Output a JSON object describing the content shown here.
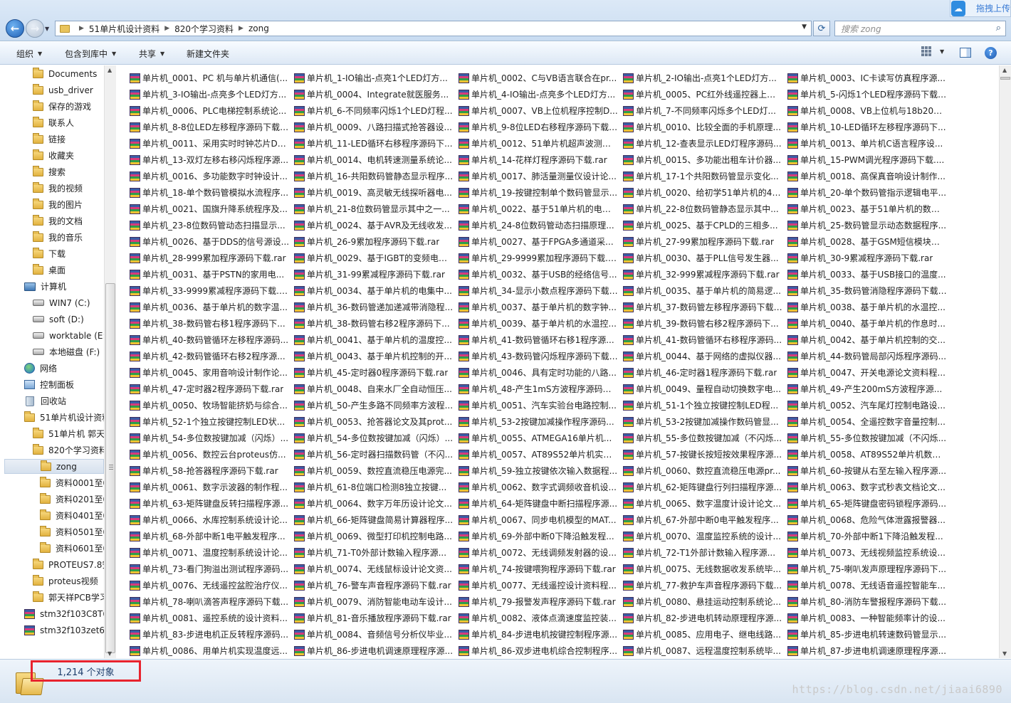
{
  "address": {
    "breadcrumbs": [
      "51单片机设计资料",
      "820个学习资料",
      "zong"
    ]
  },
  "search": {
    "placeholder": "搜索 zong"
  },
  "top_widget": {
    "label": "拖拽上传"
  },
  "toolbar": {
    "organize": "组织",
    "include_in_library": "包含到库中",
    "share": "共享",
    "new_folder": "新建文件夹"
  },
  "nav": {
    "items": [
      {
        "label": "Documents",
        "icon": "folder"
      },
      {
        "label": "usb_driver",
        "icon": "folder"
      },
      {
        "label": "保存的游戏",
        "icon": "folder"
      },
      {
        "label": "联系人",
        "icon": "folder"
      },
      {
        "label": "链接",
        "icon": "folder"
      },
      {
        "label": "收藏夹",
        "icon": "folder"
      },
      {
        "label": "搜索",
        "icon": "folder"
      },
      {
        "label": "我的视频",
        "icon": "folder"
      },
      {
        "label": "我的图片",
        "icon": "folder"
      },
      {
        "label": "我的文档",
        "icon": "folder"
      },
      {
        "label": "我的音乐",
        "icon": "folder"
      },
      {
        "label": "下载",
        "icon": "folder"
      },
      {
        "label": "桌面",
        "icon": "folder"
      },
      {
        "label": "计算机",
        "icon": "computer"
      },
      {
        "label": "WIN7 (C:)",
        "icon": "drive"
      },
      {
        "label": "soft (D:)",
        "icon": "drive"
      },
      {
        "label": "worktable (E:)",
        "icon": "drive"
      },
      {
        "label": "本地磁盘 (F:)",
        "icon": "drive"
      },
      {
        "label": "网络",
        "icon": "network"
      },
      {
        "label": "控制面板",
        "icon": "control-panel"
      },
      {
        "label": "回收站",
        "icon": "recycle-bin"
      },
      {
        "label": "51单片机设计资料",
        "icon": "folder"
      },
      {
        "label": "51单片机 郭天祥",
        "icon": "folder"
      },
      {
        "label": "820个学习资料",
        "icon": "folder"
      },
      {
        "label": "zong",
        "icon": "folder"
      },
      {
        "label": "资料0001至0200",
        "icon": "folder"
      },
      {
        "label": "资料0201至0400",
        "icon": "folder"
      },
      {
        "label": "资料0401至0500",
        "icon": "folder"
      },
      {
        "label": "资料0501至0600",
        "icon": "folder"
      },
      {
        "label": "资料0601至0820",
        "icon": "folder"
      },
      {
        "label": "PROTEUS7.8安装包",
        "icon": "folder"
      },
      {
        "label": "proteus视频",
        "icon": "folder"
      },
      {
        "label": "郭天祥PCB学习",
        "icon": "folder"
      },
      {
        "label": "stm32f103C8T6",
        "icon": "archive"
      },
      {
        "label": "stm32f103zet6",
        "icon": "archive"
      }
    ]
  },
  "files": [
    "单片机_0001、PC 机与单片机通信(...",
    "单片机_1-IO输出-点亮1个LED灯方...",
    "单片机_0002、C与VB语言联合在pr...",
    "单片机_2-IO输出-点亮1个LED灯方...",
    "单片机_0003、IC卡读写仿真程序源...",
    "单片机_3-IO输出-点亮多个LED灯方...",
    "单片机_0004、Integrate就医服务...",
    "单片机_4-IO输出-点亮多个LED灯方...",
    "单片机_0005、PC红外线遥控器上位...",
    "单片机_5-闪烁1个LED程序源码下载....",
    "单片机_0006、PLC电梯控制系统论...",
    "单片机_6-不同频率闪烁1个LED灯程...",
    "单片机_0007、VB上位机程序控制D...",
    "单片机_7-不同频率闪烁多个LED灯...",
    "单片机_0008、VB上位机与18b20下...",
    "单片机_8-8位LED左移程序源码下载....",
    "单片机_0009、八路扫描式抢答器设...",
    "单片机_9-8位LED右移程序源码下载....",
    "单片机_0010、比较全面的手机原理...",
    "单片机_10-LED循环左移程序源码下...",
    "单片机_0011、采用实时时钟芯片DS...",
    "单片机_11-LED循环右移程序源码下...",
    "单片机_0012、51单片机超声波测距...",
    "单片机_12-查表显示LED灯程序源码...",
    "单片机_0013、单片机C语言程序设...",
    "单片机_13-双灯左移右移闪烁程序源...",
    "单片机_0014、电机转速测量系统论...",
    "单片机_14-花样灯程序源码下载.rar",
    "单片机_0015、多功能出租车计价器...",
    "单片机_15-PWM调光程序源码下载....",
    "单片机_0016、多功能数字时钟设计...",
    "单片机_16-共阳数码管静态显示程序...",
    "单片机_0017、肺活量测量仪设计论...",
    "单片机_17-1个共阳数码管显示变化...",
    "单片机_0018、高保真音响设计制作...",
    "单片机_18-单个数码管模拟水流程序...",
    "单片机_0019、高灵敏无线探听器电...",
    "单片机_19-按键控制单个数码管显示...",
    "单片机_0020、给初学51单片机的40...",
    "单片机_20-单个数码管指示逻辑电平...",
    "单片机_0021、国旗升降系统程序及...",
    "单片机_21-8位数码管显示其中之一...",
    "单片机_0022、基于51单片机的电子...",
    "单片机_22-8位数码管静态显示其中...",
    "单片机_0023、基于51单片机的数字...",
    "单片机_23-8位数码管动态扫描显示...",
    "单片机_0024、基于AVR及无线收发...",
    "单片机_24-8位数码管动态扫描原理...",
    "单片机_0025、基于CPLD的三相多...",
    "单片机_25-数码管显示动态数据程序...",
    "单片机_0026、基于DDS的信号源设...",
    "单片机_26-9累加程序源码下载.rar",
    "单片机_0027、基于FPGA多通道采...",
    "单片机_27-99累加程序源码下载.rar",
    "单片机_0028、基于GSM短信模块的...",
    "单片机_28-999累加程序源码下载.rar",
    "单片机_0029、基于IGBT的变频电源...",
    "单片机_29-9999累加程序源码下载.r...",
    "单片机_0030、基于PLL信号发生器...",
    "单片机_30-9累减程序源码下载.rar",
    "单片机_0031、基于PSTN的家用电...",
    "单片机_31-99累减程序源码下载.rar",
    "单片机_0032、基于USB的经络信号...",
    "单片机_32-999累减程序源码下载.rar",
    "单片机_0033、基于USB接口的温度...",
    "单片机_33-9999累减程序源码下载.r...",
    "单片机_0034、基于单片机的电集中...",
    "单片机_34-显示小数点程序源码下载....",
    "单片机_0035、基于单片机的简易逻...",
    "单片机_35-数码管消隐程序源码下载....",
    "单片机_0036、基于单片机的数字温...",
    "单片机_36-数码管递加递减带消隐程...",
    "单片机_0037、基于单片机的数字钟...",
    "单片机_37-数码管左移程序源码下载....",
    "单片机_0038、基于单片机的水温控...",
    "单片机_38-数码管右移1程序源码下...",
    "单片机_38-数码管右移2程序源码下...",
    "单片机_0039、基于单片机的水温控...",
    "单片机_39-数码管右移2程序源码下...",
    "单片机_0040、基于单片机的作息时...",
    "单片机_40-数码管循环左移程序源码...",
    "单片机_0041、基于单片机的温度控...",
    "单片机_41-数码管循环右移1程序源...",
    "单片机_41-数码管循环右移程序源码...",
    "单片机_0042、基于单片机控制的交...",
    "单片机_42-数码管循环右移2程序源...",
    "单片机_0043、基于单片机控制的开...",
    "单片机_43-数码管闪烁程序源码下载....",
    "单片机_0044、基于网络的虚拟仪器...",
    "单片机_44-数码管局部闪烁程序源码...",
    "单片机_0045、家用音响设计制作论...",
    "单片机_45-定时器0程序源码下载.rar",
    "单片机_0046、具有定时功能的八路...",
    "单片机_46-定时器1程序源码下载.rar",
    "单片机_0047、开关电源论文资料程...",
    "单片机_47-定时器2程序源码下载.rar",
    "单片机_0048、自来水厂全自动恒压...",
    "单片机_48-产生1mS方波程序源码下...",
    "单片机_0049、量程自动切换数字电...",
    "单片机_49-产生200mS方波程序源...",
    "单片机_0050、牧场智能挤奶与综合...",
    "单片机_50-产生多路不同频率方波程...",
    "单片机_0051、汽车实验台电路控制...",
    "单片机_51-1个独立按键控制LED程...",
    "单片机_0052、汽车尾灯控制电路设...",
    "单片机_52-1个独立按键控制LED状...",
    "单片机_0053、抢答器论文及其prot...",
    "单片机_53-2按键加减操作程序源码...",
    "单片机_53-2按键加减操作数码管显...",
    "单片机_0054、全遥控数字音量控制...",
    "单片机_54-多位数按键加减（闪烁）...",
    "单片机_54-多位数按键加减（闪烁）...",
    "单片机_0055、ATMEGA16单片机...",
    "单片机_55-多位数按键加减（不闪烁...",
    "单片机_55-多位数按键加减（不闪烁...",
    "单片机_0056、数控云台proteus仿...",
    "单片机_56-定时器扫描数码管（不闪...",
    "单片机_0057、AT89S52单片机实现...",
    "单片机_57-按键长按短按效果程序源...",
    "单片机_0058、AT89S52单片机数控...",
    "单片机_58-抢答器程序源码下载.rar",
    "单片机_0059、数控直流稳压电源完...",
    "单片机_59-独立按键依次输入数据程...",
    "单片机_0060、数控直流稳压电源pr...",
    "单片机_60-按键从右至左输入程序源...",
    "单片机_0061、数字示波器的制作程...",
    "单片机_61-8位端口检测8独立按键...",
    "单片机_0062、数字式调频收音机设...",
    "单片机_62-矩阵键盘行列扫描程序源...",
    "单片机_0063、数字式秒表文档论文...",
    "单片机_63-矩阵键盘反转扫描程序源...",
    "单片机_0064、数字万年历设计论文...",
    "单片机_64-矩阵键盘中断扫描程序源...",
    "单片机_0065、数字温度计设计论文...",
    "单片机_65-矩阵键盘密码锁程序源码...",
    "单片机_0066、水库控制系统设计论...",
    "单片机_66-矩阵键盘简易计算器程序...",
    "单片机_0067、同步电机模型的MAT...",
    "单片机_67-外部中断0电平触发程序...",
    "单片机_0068、危险气体泄露报警器...",
    "单片机_68-外部中断1电平触发程序...",
    "单片机_0069、微型打印机控制电路...",
    "单片机_69-外部中断0下降沿触发程...",
    "单片机_0070、温度监控系统的设计...",
    "单片机_70-外部中断1下降沿触发程...",
    "单片机_0071、温度控制系统设计论...",
    "单片机_71-T0外部计数输入程序源...",
    "单片机_0072、无线调频发射器的设...",
    "单片机_72-T1外部计数输入程序源...",
    "单片机_0073、无线视频监控系统设...",
    "单片机_73-看门狗溢出测试程序源码...",
    "单片机_0074、无线鼠标设计论文资...",
    "单片机_74-按键喂狗程序源码下载.rar",
    "单片机_0075、无线数据收发系统毕...",
    "单片机_75-喇叭发声原理程序源码下...",
    "单片机_0076、无线遥控盆腔治疗仪...",
    "单片机_76-警车声音程序源码下载.rar",
    "单片机_0077、无线遥控设计资料程...",
    "单片机_77-救护车声音程序源码下载...",
    "单片机_0078、无线语音遥控智能车...",
    "单片机_78-喇叭滴答声程序源码下载...",
    "单片机_0079、消防智能电动车设计...",
    "单片机_79-报警发声程序源码下载.rar",
    "单片机_0080、悬挂运动控制系统论...",
    "单片机_80-消防车警报程序源码下载...",
    "单片机_0081、遥控系统的设计资料...",
    "单片机_81-音乐播放程序源码下载.rar",
    "单片机_0082、液体点滴速度监控装...",
    "单片机_82-步进电机转动原理程序源...",
    "单片机_0083、一种智能频率计的设...",
    "单片机_83-步进电机正反转程序源码...",
    "单片机_0084、音频信号分析仪毕业...",
    "单片机_84-步进电机按键控制程序源...",
    "单片机_0085、应用电子、继电线路...",
    "单片机_85-步进电机转速数码管显示...",
    "单片机_0086、用单片机实现温度远...",
    "单片机_86-步进电机调速原理程序源...",
    "单片机_86-双步进电机综合控制程序...",
    "单片机_0087、远程温度控制系统毕...",
    "单片机_87-步进电机调速原理程序源..."
  ],
  "status": {
    "count": "1,214 个对象",
    "highlight_color": "#e8232e"
  },
  "watermark": "https://blog.csdn.net/jiaai6890"
}
